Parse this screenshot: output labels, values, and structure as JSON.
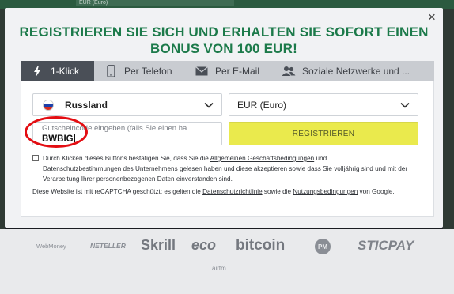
{
  "background": {
    "top_field_value": "EUR (Euro)"
  },
  "modal": {
    "close_glyph": "×",
    "headline": "REGISTRIEREN SIE SICH UND ERHALTEN SIE SOFORT EINEN BONUS VON 100 EUR!",
    "tabs": [
      {
        "label": "1-Klick",
        "icon": "lightning-icon",
        "active": true
      },
      {
        "label": "Per Telefon",
        "icon": "phone-icon",
        "active": false
      },
      {
        "label": "Per E-Mail",
        "icon": "envelope-icon",
        "active": false
      },
      {
        "label": "Soziale Netzwerke und ...",
        "icon": "users-icon",
        "active": false
      }
    ],
    "form": {
      "country": {
        "value": "Russland",
        "flag": "russia-flag-icon"
      },
      "currency": {
        "value": "EUR (Euro)"
      },
      "promo": {
        "placeholder": "Gutscheincode eingeben (falls Sie einen ha...",
        "value": "BWBIG"
      },
      "register_label": "REGISTRIEREN",
      "consent": {
        "checked": false,
        "p1": "Durch Klicken dieses Buttons bestätigen Sie, dass Sie die ",
        "link1": "Allgemeinen Geschäftsbedingungen",
        "p2": " und ",
        "link2": "Datenschutzbestimmungen",
        "p3": " des Unternehmens gelesen haben und diese akzeptieren sowie dass Sie volljährig sind und mit der Verarbeitung Ihrer personenbezogenen Daten einverstanden sind."
      },
      "captcha": {
        "p1": "Diese Website ist mit reCAPTCHA geschützt; es gelten die ",
        "link1": "Datenschutzrichtlinie",
        "p2": " sowie die ",
        "link2": "Nutzungsbedingungen",
        "p3": " von Google."
      }
    }
  },
  "payments": {
    "webmoney": "WebMoney",
    "neteller": "NETELLER",
    "skrill": "Skrill",
    "eco": "eco",
    "bitcoin": "bitcoin",
    "pm": "PM",
    "sticpay": "STICPAY",
    "airtm": "airtm"
  },
  "colors": {
    "headline_green": "#1c7a4a",
    "register_yellow": "#eaea4d",
    "active_tab": "#4a4f57",
    "annotation_red": "#e30d12"
  }
}
